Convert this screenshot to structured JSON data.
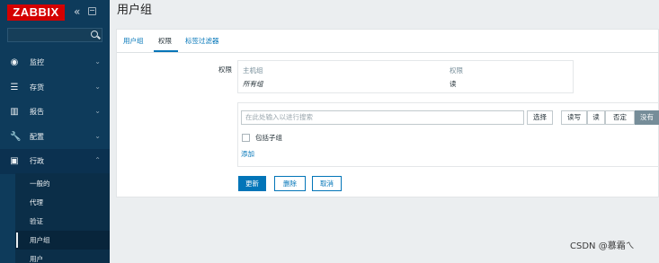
{
  "brand": {
    "logo": "ZABBIX",
    "collapse_icon": "«"
  },
  "sidebar": {
    "search": {
      "placeholder": "",
      "value": ""
    },
    "items": [
      {
        "label": "监控",
        "icon": "eye-icon",
        "glyph": "◉",
        "chevron": "⌄"
      },
      {
        "label": "存货",
        "icon": "list-icon",
        "glyph": "☰",
        "chevron": "⌄"
      },
      {
        "label": "报告",
        "icon": "report-chart-icon",
        "glyph": "▥",
        "chevron": "⌄"
      },
      {
        "label": "配置",
        "icon": "wrench-icon",
        "glyph": "🔧",
        "chevron": "⌄"
      },
      {
        "label": "行政",
        "icon": "admin-gear-icon",
        "glyph": "▣",
        "chevron": "⌃"
      }
    ],
    "submenu": [
      {
        "label": "一般的"
      },
      {
        "label": "代理"
      },
      {
        "label": "验证"
      },
      {
        "label": "用户组"
      },
      {
        "label": "用户"
      }
    ]
  },
  "page": {
    "title": "用户组"
  },
  "tabs": [
    {
      "label": "用户组"
    },
    {
      "label": "权限"
    },
    {
      "label": "标签过滤器"
    }
  ],
  "permissions": {
    "label": "权限",
    "col_host_group": "主机组",
    "col_permission": "权限",
    "row_group": "所有组",
    "row_permission": "读"
  },
  "picker": {
    "placeholder": "在此处输入以进行搜索",
    "select_label": "选择",
    "options": [
      "读写",
      "读",
      "否定",
      "没有"
    ],
    "selected_option": "没有",
    "include_subgroups": "包括子组",
    "add_link": "添加"
  },
  "actions": {
    "update": "更新",
    "delete": "删除",
    "cancel": "取消"
  },
  "watermark": "CSDN @慕霜ㄟ",
  "colors": {
    "sidebar": "#0e3b5b",
    "logo_bg": "#d40000",
    "link": "#0275b8"
  }
}
